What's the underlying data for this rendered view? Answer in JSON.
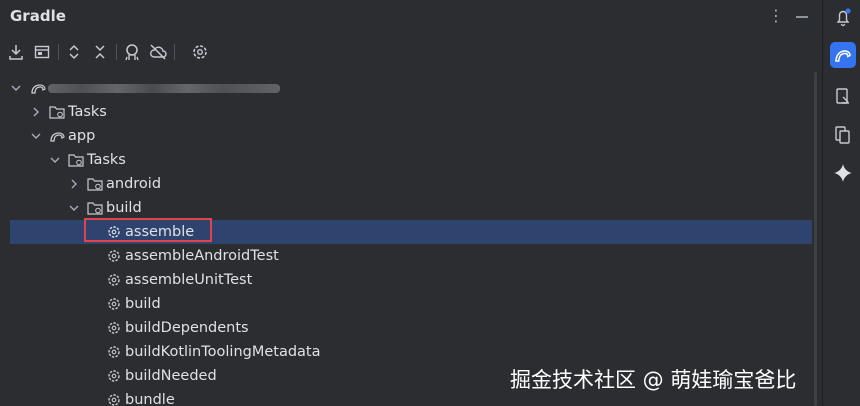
{
  "header": {
    "title": "Gradle"
  },
  "tree": {
    "root_label": "",
    "rows": [
      {
        "label": "Tasks"
      },
      {
        "label": "app"
      },
      {
        "label": "Tasks"
      },
      {
        "label": "android"
      },
      {
        "label": "build"
      },
      {
        "label": "assemble"
      },
      {
        "label": "assembleAndroidTest"
      },
      {
        "label": "assembleUnitTest"
      },
      {
        "label": "build"
      },
      {
        "label": "buildDependents"
      },
      {
        "label": "buildKotlinToolingMetadata"
      },
      {
        "label": "buildNeeded"
      },
      {
        "label": "bundle"
      }
    ]
  },
  "colors": {
    "accent": "#3574f0",
    "selection": "#2e436e",
    "highlight_box": "#e0454b",
    "background": "#2b2d30"
  },
  "watermark": "掘金技术社区 @ 萌娃瑜宝爸比"
}
